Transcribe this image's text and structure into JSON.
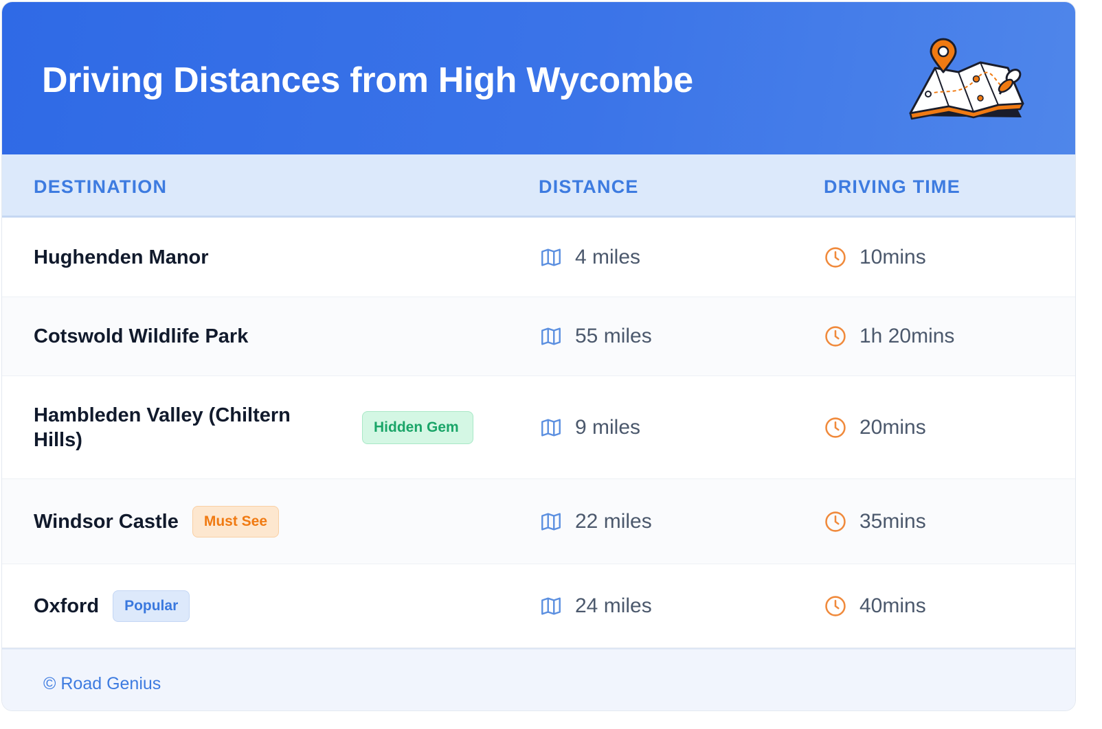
{
  "header": {
    "title": "Driving Distances from High Wycombe"
  },
  "columns": {
    "destination": "DESTINATION",
    "distance": "DISTANCE",
    "time": "DRIVING TIME"
  },
  "rows": [
    {
      "name": "Hughenden Manor",
      "badge": "",
      "distance": "4 miles",
      "time": "10mins"
    },
    {
      "name": "Cotswold Wildlife Park",
      "badge": "",
      "distance": "55 miles",
      "time": "1h 20mins"
    },
    {
      "name": "Hambleden Valley (Chiltern Hills)",
      "badge": "Hidden Gem",
      "distance": "9 miles",
      "time": "20mins"
    },
    {
      "name": "Windsor Castle",
      "badge": "Must See",
      "distance": "22 miles",
      "time": "35mins"
    },
    {
      "name": "Oxford",
      "badge": "Popular",
      "distance": "24 miles",
      "time": "40mins"
    }
  ],
  "footer": {
    "credit": "© Road Genius"
  },
  "icons": {
    "distance": "map-icon",
    "time": "clock-icon",
    "header": "map-pin-illustration"
  },
  "colors": {
    "header": "#2f6ae6",
    "accent_blue": "#3d7be0",
    "accent_orange": "#f07a12",
    "accent_green": "#1aa568"
  }
}
